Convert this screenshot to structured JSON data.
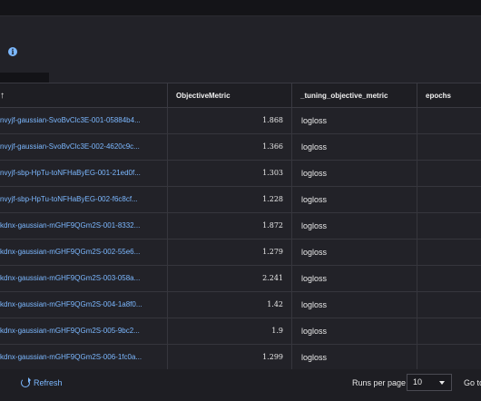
{
  "header": {
    "sort_arrow": "↑",
    "info_icon": "info-icon"
  },
  "table": {
    "columns": [
      "ObjectiveMetric",
      "_tuning_objective_metric",
      "epochs"
    ],
    "rows": [
      {
        "name": "nvyjf-gaussian-SvoBvClc3E-001-05884b4...",
        "objective": "1.868",
        "metric": "logloss",
        "epochs": ""
      },
      {
        "name": "nvyjf-gaussian-SvoBvClc3E-002-4620c9c...",
        "objective": "1.366",
        "metric": "logloss",
        "epochs": ""
      },
      {
        "name": "nvyjf-sbp-HpTu-toNFHaByEG-001-21ed0f...",
        "objective": "1.303",
        "metric": "logloss",
        "epochs": ""
      },
      {
        "name": "nvyjf-sbp-HpTu-toNFHaByEG-002-f6c8cf...",
        "objective": "1.228",
        "metric": "logloss",
        "epochs": ""
      },
      {
        "name": "kdnx-gaussian-mGHF9QGm2S-001-8332...",
        "objective": "1.872",
        "metric": "logloss",
        "epochs": ""
      },
      {
        "name": "kdnx-gaussian-mGHF9QGm2S-002-55e6...",
        "objective": "1.279",
        "metric": "logloss",
        "epochs": ""
      },
      {
        "name": "kdnx-gaussian-mGHF9QGm2S-003-058a...",
        "objective": "2.241",
        "metric": "logloss",
        "epochs": ""
      },
      {
        "name": "kdnx-gaussian-mGHF9QGm2S-004-1a8f0...",
        "objective": "1.42",
        "metric": "logloss",
        "epochs": ""
      },
      {
        "name": "kdnx-gaussian-mGHF9QGm2S-005-9bc2...",
        "objective": "1.9",
        "metric": "logloss",
        "epochs": ""
      },
      {
        "name": "kdnx-gaussian-mGHF9QGm2S-006-1fc0a...",
        "objective": "1.299",
        "metric": "logloss",
        "epochs": ""
      }
    ]
  },
  "footer": {
    "refresh_label": "Refresh",
    "rows_per_page_label": "Runs per page",
    "rows_per_page_value": "10",
    "goto_label": "Go to"
  },
  "colors": {
    "accent": "#7cb8ff",
    "background": "#222228"
  }
}
